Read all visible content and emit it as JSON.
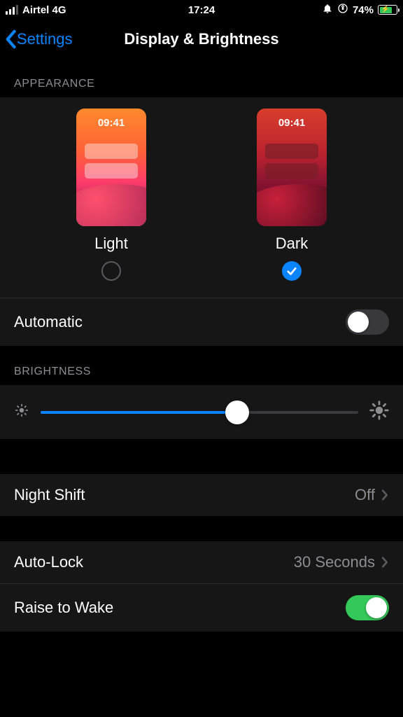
{
  "status": {
    "carrier": "Airtel 4G",
    "time": "17:24",
    "battery_pct": "74%"
  },
  "nav": {
    "back_label": "Settings",
    "title": "Display & Brightness"
  },
  "appearance": {
    "header": "APPEARANCE",
    "preview_time": "09:41",
    "light_label": "Light",
    "dark_label": "Dark",
    "selected": "dark",
    "automatic_label": "Automatic",
    "automatic_on": false
  },
  "brightness": {
    "header": "BRIGHTNESS",
    "value_pct": 62
  },
  "night_shift": {
    "label": "Night Shift",
    "value": "Off"
  },
  "auto_lock": {
    "label": "Auto-Lock",
    "value": "30 Seconds"
  },
  "raise_to_wake": {
    "label": "Raise to Wake",
    "on": true
  }
}
